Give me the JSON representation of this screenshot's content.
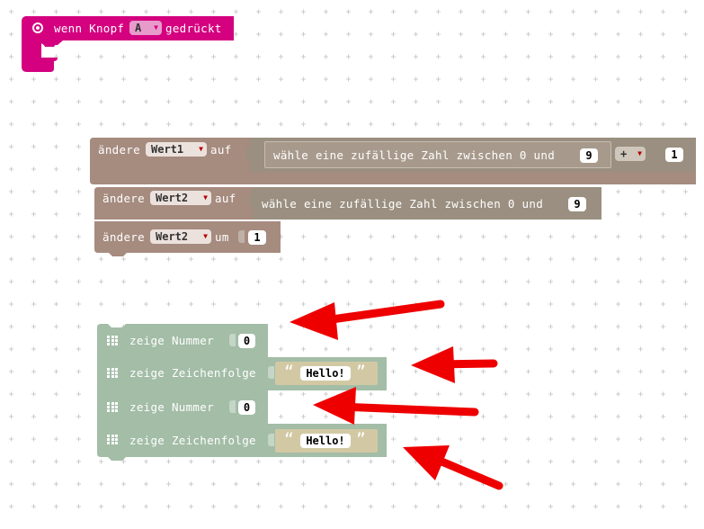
{
  "event_block": {
    "label_prefix": "wenn Knopf",
    "button_value": "A",
    "label_suffix": "gedrückt",
    "color": "#d4007f"
  },
  "set_blocks": [
    {
      "label_prefix": "ändere",
      "variable": "Wert1",
      "label_mode": "auf",
      "random_label": "wähle eine zufällige Zahl zwischen 0 und",
      "random_max": "9",
      "operator": "+",
      "operand": "1"
    },
    {
      "label_prefix": "ändere",
      "variable": "Wert2",
      "label_mode": "auf",
      "random_label": "wähle eine zufällige Zahl zwischen 0 und",
      "random_max": "9"
    },
    {
      "label_prefix": "ändere",
      "variable": "Wert2",
      "label_mode": "um",
      "value": "1"
    }
  ],
  "show_blocks": [
    {
      "label": "zeige Nummer",
      "value": "0"
    },
    {
      "label": "zeige Zeichenfolge",
      "value": "Hello!"
    },
    {
      "label": "zeige Nummer",
      "value": "0"
    },
    {
      "label": "zeige Zeichenfolge",
      "value": "Hello!"
    }
  ],
  "quote_open": "“",
  "quote_close": "”",
  "colors": {
    "variables": "#a68b7f",
    "math": "#9a8f80",
    "basic": "#a3bda7",
    "string_field": "#d2c9a4",
    "annotation_arrow": "#ee0000"
  },
  "icons": {
    "event_icon": "radio-button-icon",
    "basic_icon": "led-grid-icon",
    "dropdown_arrow": "triangle-down-icon"
  }
}
